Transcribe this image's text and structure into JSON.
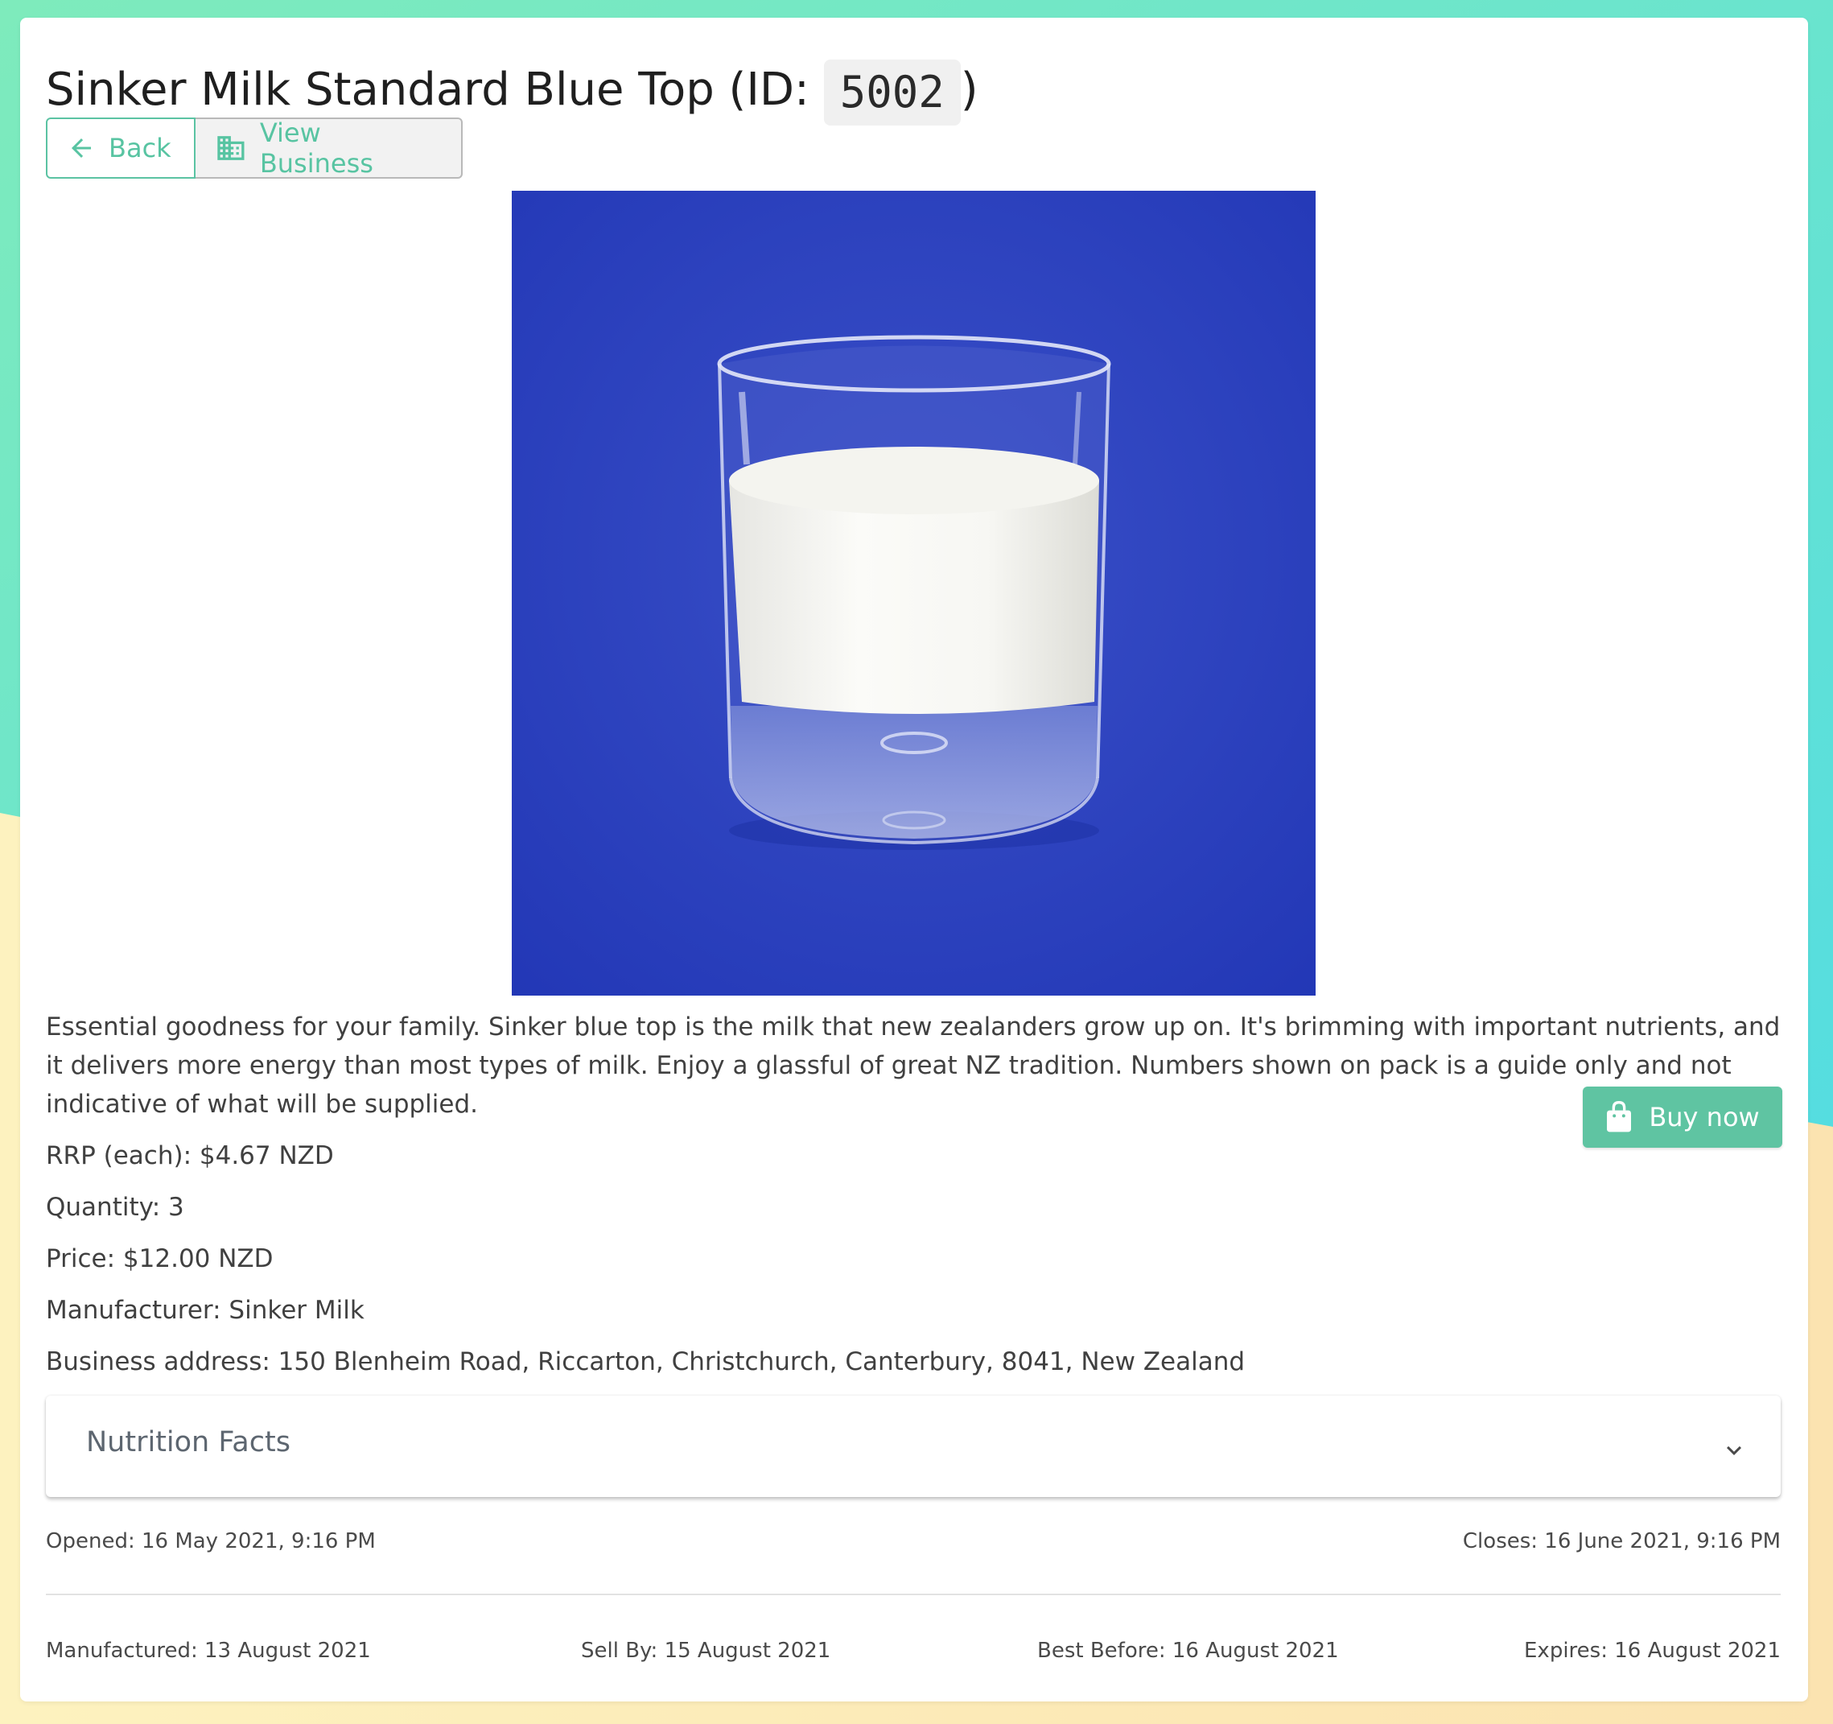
{
  "product": {
    "title_prefix": "Sinker Milk Standard Blue Top (ID: ",
    "id": "5002",
    "title_suffix": ")",
    "image_alt": "Glass of milk on a blue background",
    "description": "Essential goodness for your family. Sinker blue top is the milk that new zealanders grow up on. It's brimming with important nutrients, and it delivers more energy than most types of milk. Enjoy a glassful of great NZ tradition. Numbers shown on pack is a guide only and not indicative of what will be supplied.",
    "rrp": "RRP (each): $4.67 NZD",
    "quantity": "Quantity: 3",
    "price": "Price: $12.00 NZD",
    "manufacturer": "Manufacturer: Sinker Milk",
    "business_address": "Business address: 150 Blenheim Road, Riccarton, Christchurch, Canterbury, 8041, New Zealand"
  },
  "actions": {
    "back_label": "Back",
    "view_business_label": "View Business",
    "buy_label": "Buy now"
  },
  "icons": {
    "back": "arrow-left-icon",
    "view_business": "building-icon",
    "buy": "shopping-bag-icon",
    "expand": "chevron-down-icon"
  },
  "nutrition": {
    "title": "Nutrition Facts",
    "expanded": false
  },
  "listing": {
    "opened": "Opened: 16 May 2021, 9:16 PM",
    "closes": "Closes: 16 June 2021, 9:16 PM",
    "manufactured": "Manufactured: 13 August 2021",
    "sell_by": "Sell By: 15 August 2021",
    "best_before": "Best Before: 16 August 2021",
    "expires": "Expires: 16 August 2021"
  },
  "colors": {
    "accent": "#5bc3a3",
    "button_fill": "#5fc4a2",
    "background_top": "#7de8c0",
    "background_bottom": "#fdf1bc",
    "photo_background": "#2f43c0"
  }
}
